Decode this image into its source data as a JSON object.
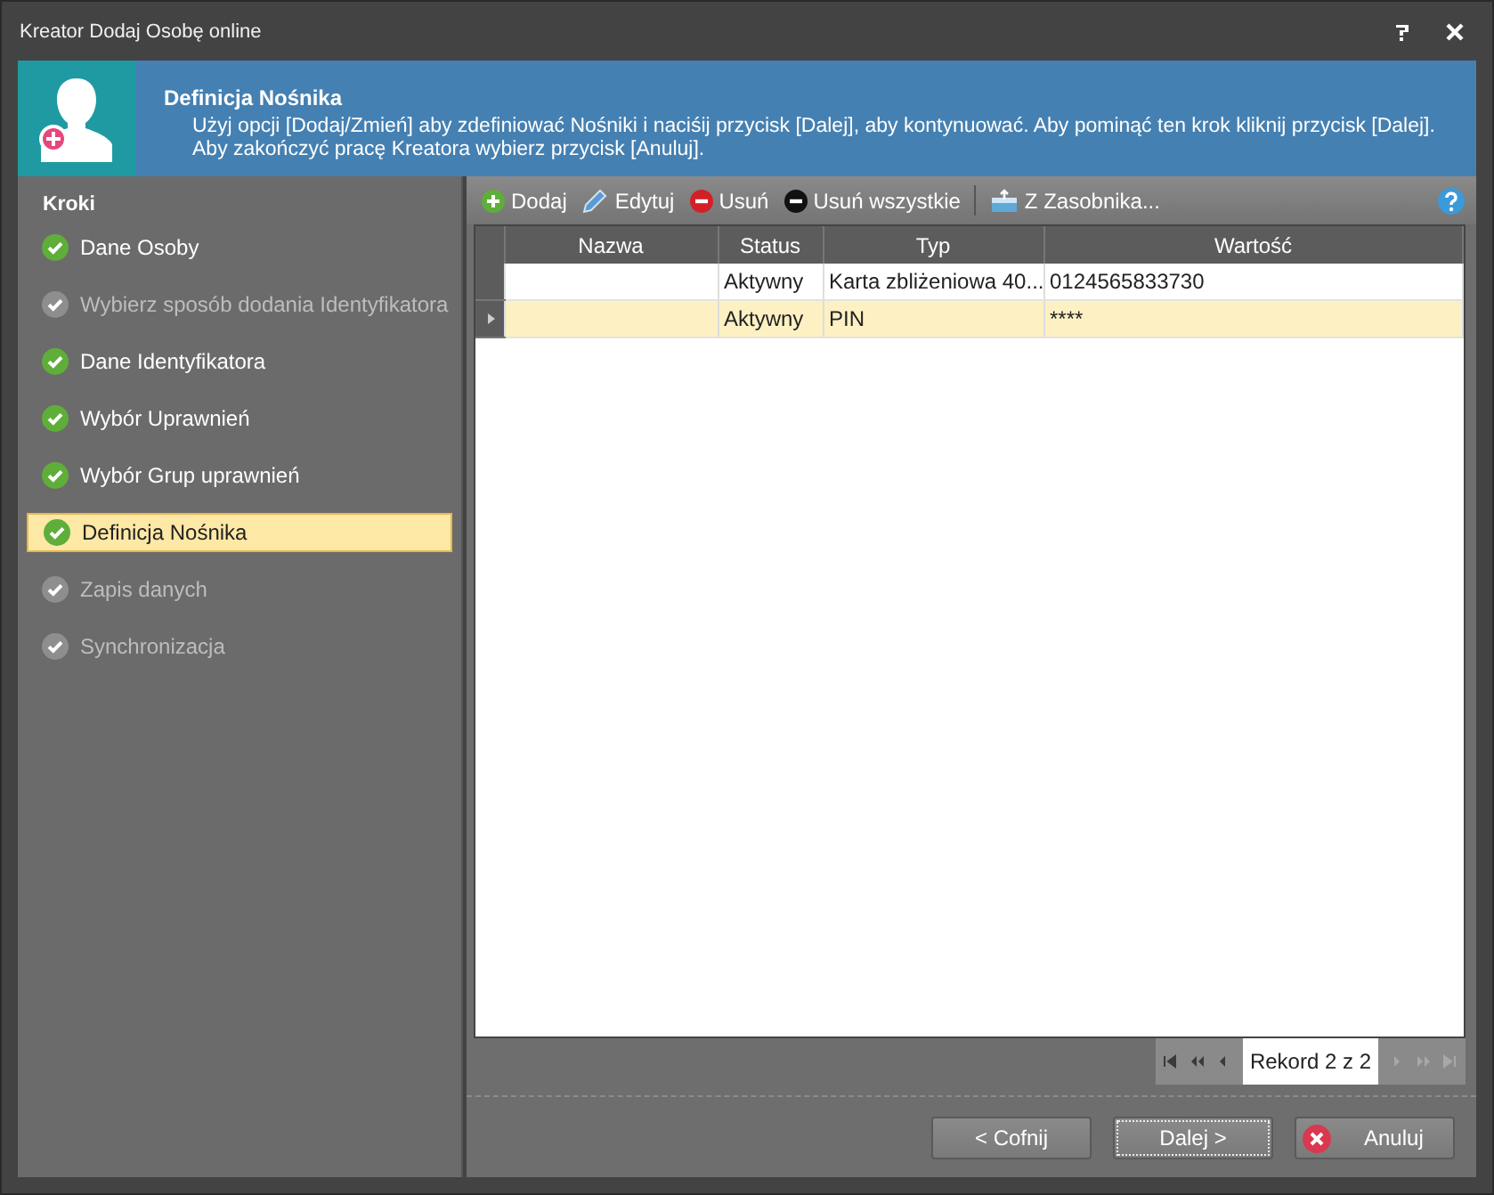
{
  "window": {
    "title": "Kreator Dodaj Osobę online",
    "controls": [
      {
        "kind": "help"
      },
      {
        "kind": "close"
      }
    ]
  },
  "banner": {
    "title": "Definicja Nośnika",
    "lines": [
      "Użyj opcji [Dodaj/Zmień] aby zdefiniować Nośniki i naciśij przycisk [Dalej], aby kontynuować. Aby pominąć ten krok kliknij przycisk [Dalej].",
      "Aby zakończyć pracę Kreatora wybierz przycisk [Anuluj]."
    ]
  },
  "steps": {
    "title": "Kroki",
    "items": [
      {
        "label": "Dane Osoby",
        "disabled": false,
        "selected": false
      },
      {
        "label": "Wybierz sposób dodania Identyfikatora",
        "disabled": true,
        "selected": false
      },
      {
        "label": "Dane Identyfikatora",
        "disabled": false,
        "selected": false
      },
      {
        "label": "Wybór Uprawnień",
        "disabled": false,
        "selected": false
      },
      {
        "label": "Wybór Grup uprawnień",
        "disabled": false,
        "selected": false
      },
      {
        "label": "Definicja Nośnika",
        "disabled": false,
        "selected": true
      },
      {
        "label": "Zapis danych",
        "disabled": true,
        "selected": false
      },
      {
        "label": "Synchronizacja",
        "disabled": true,
        "selected": false
      }
    ]
  },
  "toolbar": [
    {
      "kind": "add",
      "label": "Dodaj"
    },
    {
      "kind": "edit",
      "label": "Edytuj"
    },
    {
      "kind": "remove",
      "label": "Usuń"
    },
    {
      "kind": "remove-all",
      "label": "Usuń wszystkie"
    },
    {
      "kind": "separator"
    },
    {
      "kind": "store",
      "label": "Z Zasobnika..."
    },
    {
      "kind": "help"
    }
  ],
  "table": {
    "columns": [
      "Nazwa",
      "Status",
      "Typ",
      "Wartość"
    ],
    "rows": [
      {
        "cells": [
          "",
          "Aktywny",
          "Karta zbliżeniowa 40...",
          "0124565833730"
        ],
        "selected": false
      },
      {
        "cells": [
          "",
          "Aktywny",
          "PIN",
          "****"
        ],
        "selected": true
      }
    ]
  },
  "pager": {
    "buttons": [
      {
        "kind": "first",
        "disabled": false
      },
      {
        "kind": "prev-page",
        "disabled": false
      },
      {
        "kind": "prev",
        "disabled": false
      },
      {
        "kind": "text"
      },
      {
        "kind": "next",
        "disabled": true
      },
      {
        "kind": "next-page",
        "disabled": true
      },
      {
        "kind": "last",
        "disabled": true
      }
    ],
    "text": "Rekord 2 z 2"
  },
  "buttons": [
    {
      "kind": "back",
      "label": "< Cofnij",
      "focused": false
    },
    {
      "kind": "next",
      "label": "Dalej >",
      "focused": true
    },
    {
      "kind": "cancel",
      "label": "Anuluj",
      "focused": false
    }
  ]
}
